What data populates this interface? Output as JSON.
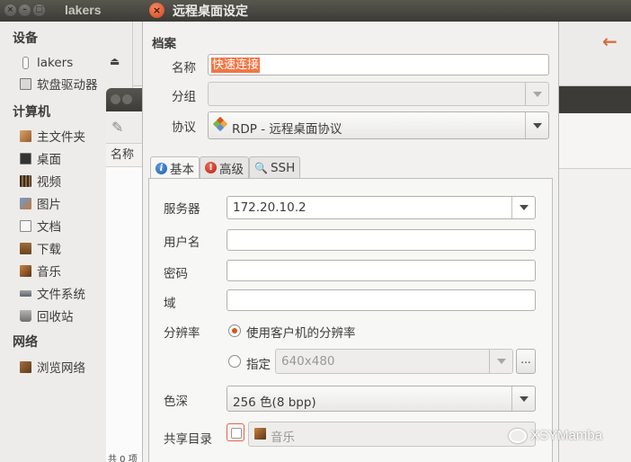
{
  "background_window": {
    "title": "lakers",
    "buttons": [
      "×",
      "–",
      "□"
    ],
    "sidebar": {
      "devices_header": "设备",
      "devices": [
        "lakers",
        "软盘驱动器"
      ],
      "computer_header": "计算机",
      "computer": [
        "主文件夹",
        "桌面",
        "视频",
        "图片",
        "文档",
        "下载",
        "音乐",
        "文件系统",
        "回收站"
      ],
      "network_header": "网络",
      "network": [
        "浏览网络"
      ]
    },
    "back_arrow": "←"
  },
  "second_window": {
    "column_header": "名称",
    "footer_text": "共 0 项"
  },
  "dialog": {
    "title": "远程桌面设定",
    "close_glyph": "×",
    "section_title": "档案",
    "name_label": "名称",
    "name_value": "快速连接",
    "group_label": "分组",
    "group_value": "",
    "protocol_label": "协议",
    "protocol_value": "RDP - 远程桌面协议",
    "tabs": [
      {
        "label": "基本",
        "icon": "info-icon"
      },
      {
        "label": "高级",
        "icon": "advanced-icon"
      },
      {
        "label": "SSH",
        "icon": "ssh-icon"
      }
    ],
    "basic": {
      "server_label": "服务器",
      "server_value": "172.20.10.2",
      "username_label": "用户名",
      "username_value": "",
      "password_label": "密码",
      "password_value": "",
      "domain_label": "域",
      "domain_value": "",
      "resolution_label": "分辨率",
      "resolution_option_client": "使用客户机的分辨率",
      "resolution_option_custom": "指定",
      "resolution_custom_value": "640x480",
      "resolution_more_button": "...",
      "color_depth_label": "色深",
      "color_depth_value": "256 色(8 bpp)",
      "shared_folder_label": "共享目录",
      "shared_folder_value": "音乐"
    }
  },
  "watermark": "XSYMamba",
  "colors": {
    "accent_orange": "#f07746",
    "titlebar_dark": "#3c3b37",
    "close_button": "#e2542a"
  }
}
